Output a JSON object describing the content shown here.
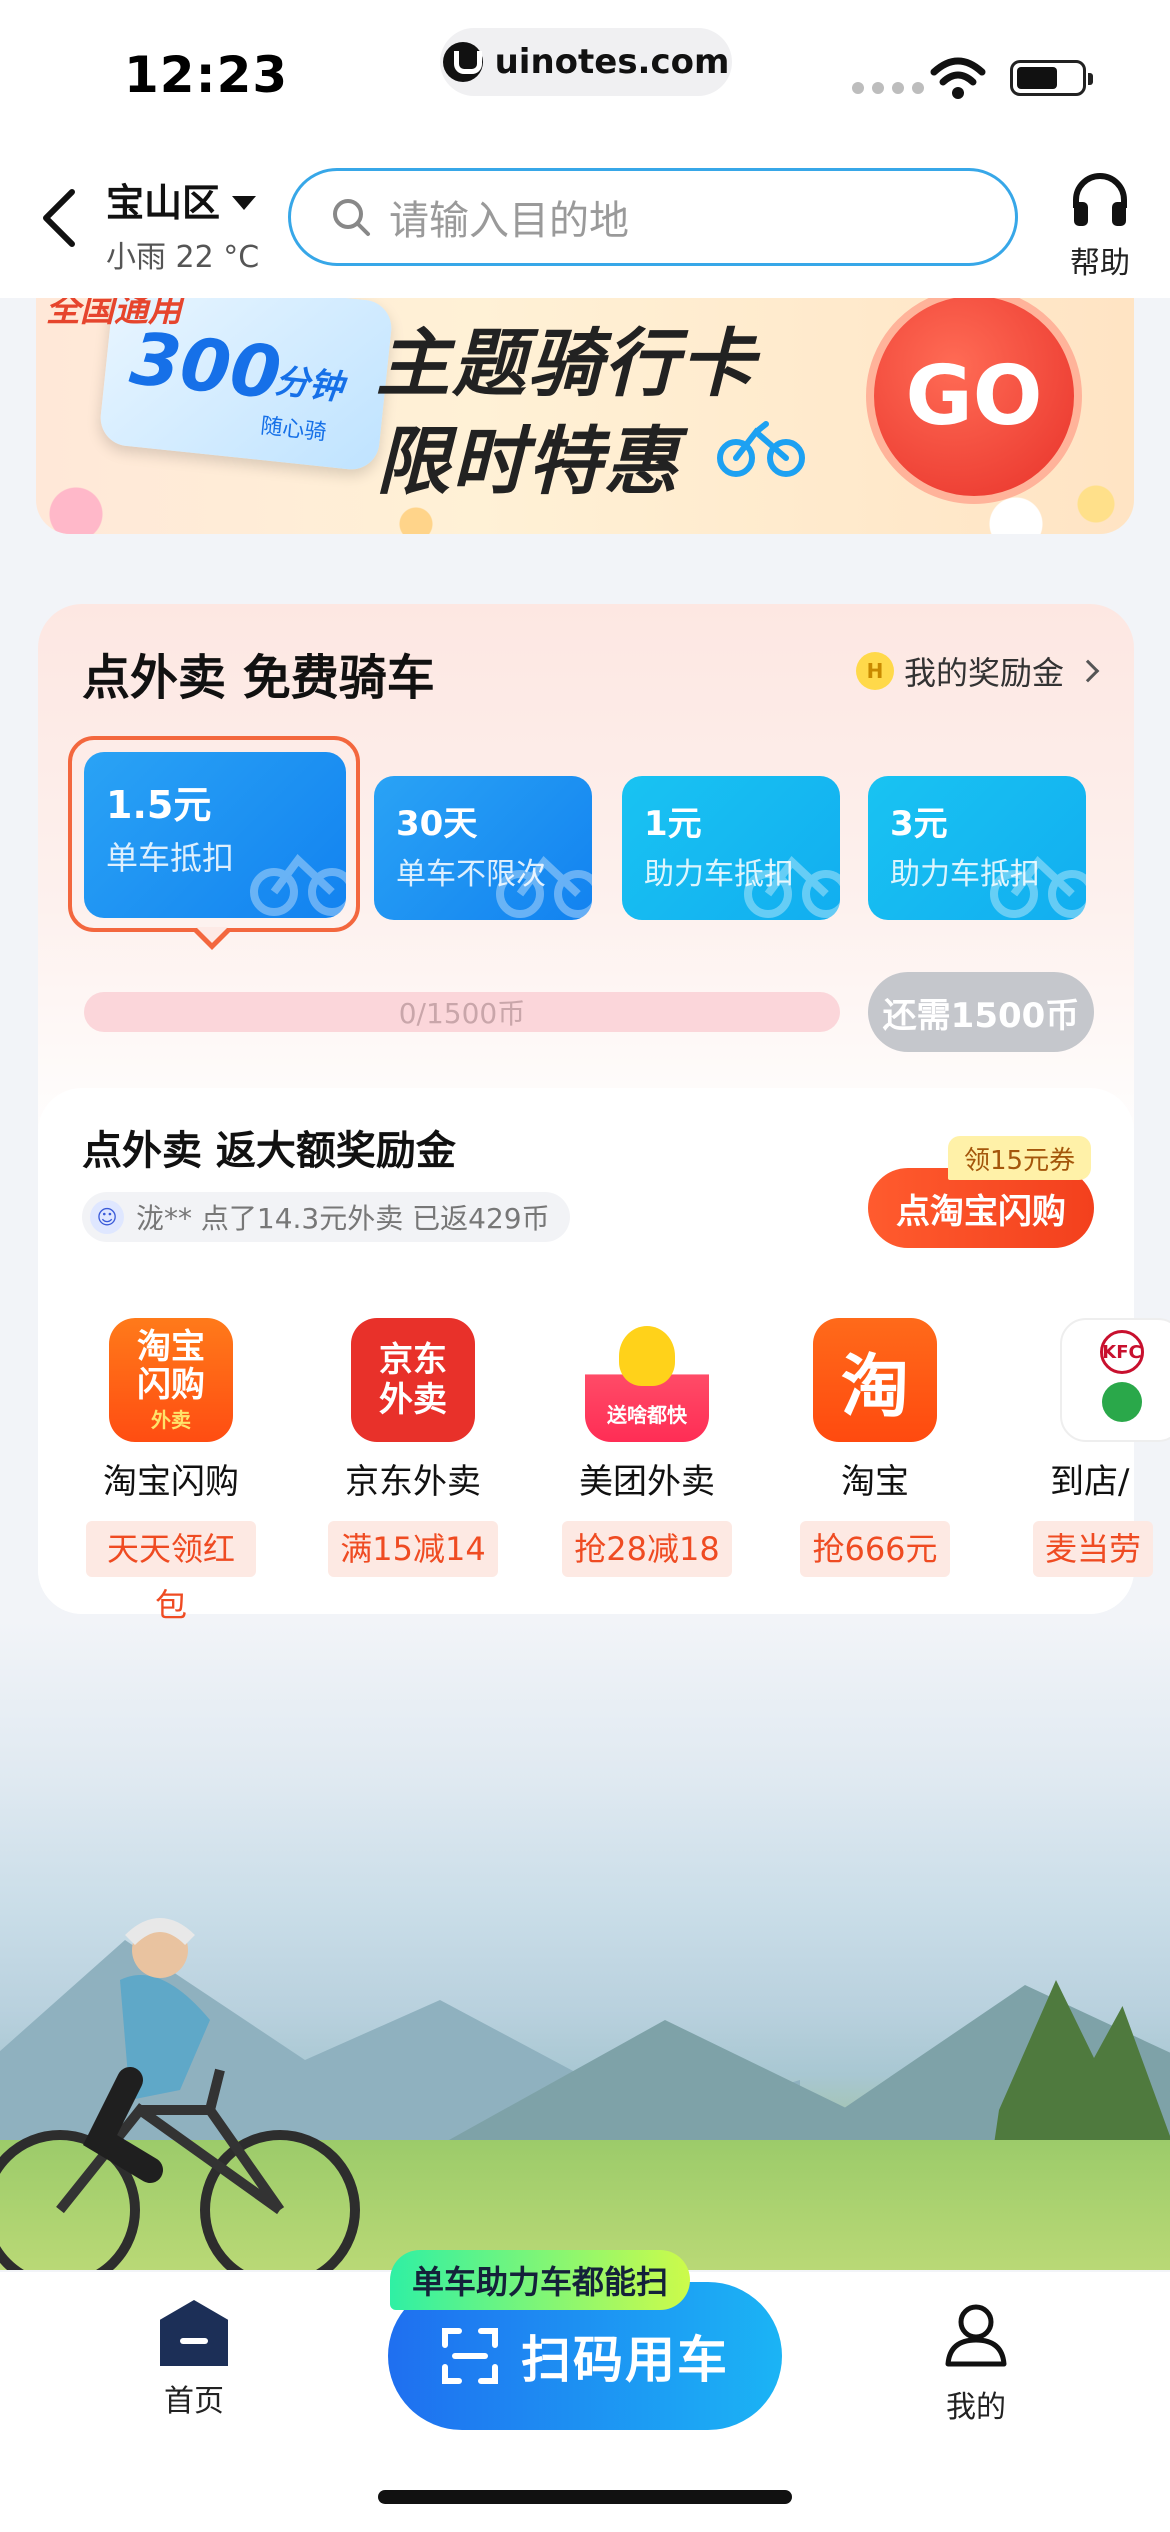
{
  "status_bar": {
    "time": "12:23",
    "url": "uinotes.com"
  },
  "header": {
    "city": "宝山区",
    "weather": "小雨 22 °C",
    "search_placeholder": "请输入目的地",
    "help_label": "帮助"
  },
  "banner": {
    "badge_top": "全国通用",
    "card_big": "300",
    "card_unit": "分钟",
    "card_sub": "随心骑",
    "title_line1": "主题骑行卡",
    "title_line2": "限时特惠",
    "go_label": "GO"
  },
  "reward_card": {
    "title": "点外卖 免费骑车",
    "reward_link": "我的奖励金",
    "coin_letter": "H",
    "tiles": [
      {
        "value": "1.5元",
        "desc": "单车抵扣",
        "selected": true
      },
      {
        "value": "30天",
        "desc": "单车不限次",
        "selected": false
      },
      {
        "value": "1元",
        "desc": "助力车抵扣",
        "selected": false
      },
      {
        "value": "3元",
        "desc": "助力车抵扣",
        "selected": false
      }
    ],
    "progress_text": "0/1500币",
    "progress_fraction": 0,
    "need_button": "还需1500币"
  },
  "takeout": {
    "title": "点外卖 返大额奖励金",
    "feed_text": "泷** 点了14.3元外卖 已返429币",
    "cta_label": "点淘宝闪购",
    "coupon_label": "领15元券",
    "apps": [
      {
        "name": "淘宝闪购",
        "tag": "天天领红包",
        "icon_line1": "淘宝",
        "icon_line2": "闪购",
        "icon_line3": "外卖"
      },
      {
        "name": "京东外卖",
        "tag": "满15减14",
        "icon_line1": "京东",
        "icon_line2": "外卖"
      },
      {
        "name": "美团外卖",
        "tag": "抢28减18",
        "icon_line1": "送啥都快"
      },
      {
        "name": "淘宝",
        "tag": "抢666元",
        "icon_line1": "淘"
      },
      {
        "name": "到店∕",
        "tag": "麦当劳",
        "icon_line1": "KFC"
      }
    ]
  },
  "bottom_bar": {
    "home_label": "首页",
    "scan_label": "扫码用车",
    "scan_tag": "单车助力车都能扫",
    "me_label": "我的"
  }
}
